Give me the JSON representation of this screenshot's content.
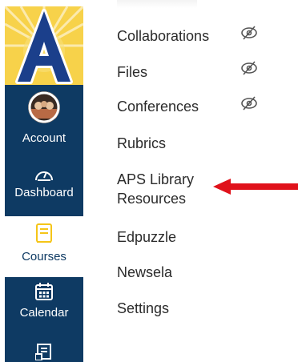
{
  "global_nav": {
    "logo": {
      "letter": "A",
      "colors": {
        "sun": "#f7d24a",
        "letter": "#1b3f8b"
      }
    },
    "items": [
      {
        "label": "Account",
        "icon": "avatar",
        "active": false
      },
      {
        "label": "Dashboard",
        "icon": "speedometer-icon",
        "active": false
      },
      {
        "label": "Courses",
        "icon": "book-icon",
        "active": true
      },
      {
        "label": "Calendar",
        "icon": "calendar-icon",
        "active": false
      },
      {
        "label": "",
        "icon": "inbox-icon",
        "active": false
      }
    ],
    "colors": {
      "background": "#0e3a63",
      "active_icon": "#f5c518"
    }
  },
  "course_nav": {
    "items": [
      {
        "label": "Collaborations",
        "hidden_from_students": true
      },
      {
        "label": "Files",
        "hidden_from_students": true
      },
      {
        "label": "Conferences",
        "hidden_from_students": true
      },
      {
        "label": "Rubrics",
        "hidden_from_students": false
      },
      {
        "label": "APS Library",
        "label_line2": "Resources",
        "hidden_from_students": false
      },
      {
        "label": "Edpuzzle",
        "hidden_from_students": false
      },
      {
        "label": "Newsela",
        "hidden_from_students": false
      },
      {
        "label": "Settings",
        "hidden_from_students": false
      }
    ]
  },
  "annotation": {
    "type": "arrow",
    "color": "#e0121b",
    "points_to": "APS Library Resources"
  }
}
